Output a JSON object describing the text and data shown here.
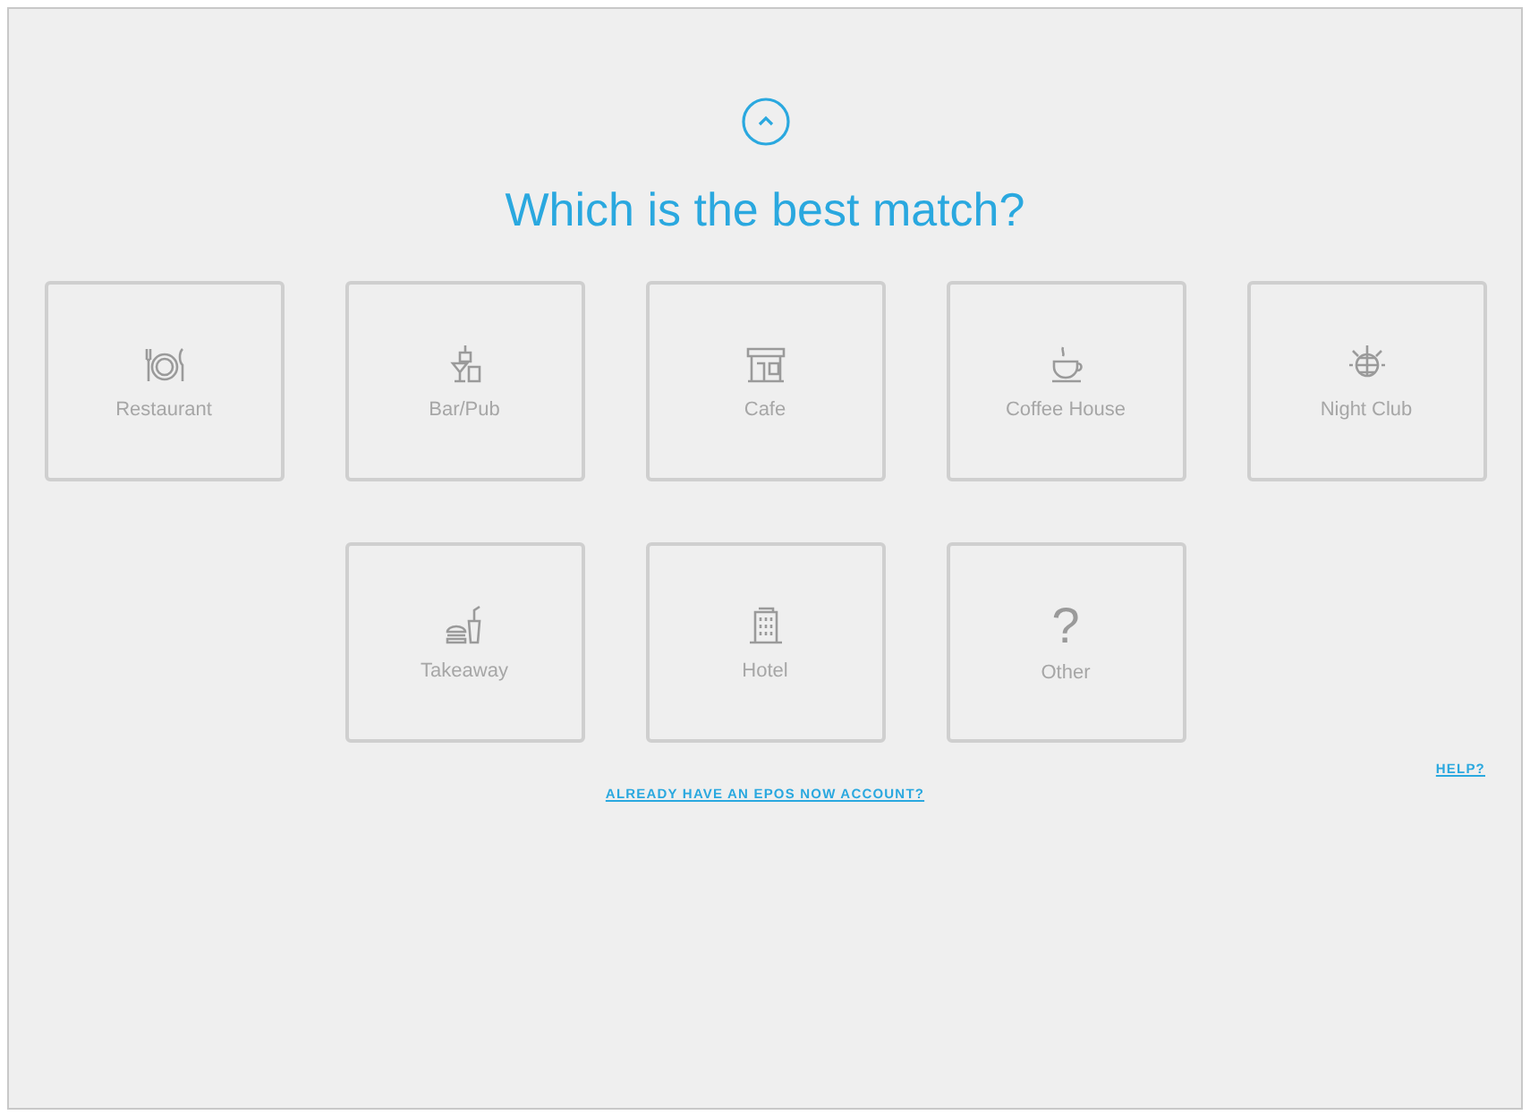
{
  "heading": "Which is the best match?",
  "rows": [
    [
      {
        "kind": "restaurant",
        "label": "Restaurant"
      },
      {
        "kind": "bar",
        "label": "Bar/Pub"
      },
      {
        "kind": "cafe",
        "label": "Cafe"
      },
      {
        "kind": "coffee",
        "label": "Coffee House"
      },
      {
        "kind": "club",
        "label": "Night Club"
      }
    ],
    [
      {
        "kind": "takeaway",
        "label": "Takeaway"
      },
      {
        "kind": "hotel",
        "label": "Hotel"
      },
      {
        "kind": "glyph",
        "glyph": "?",
        "label": "Other"
      }
    ]
  ],
  "account_link": "ALREADY HAVE AN EPOS NOW ACCOUNT?",
  "help_link": "HELP?"
}
